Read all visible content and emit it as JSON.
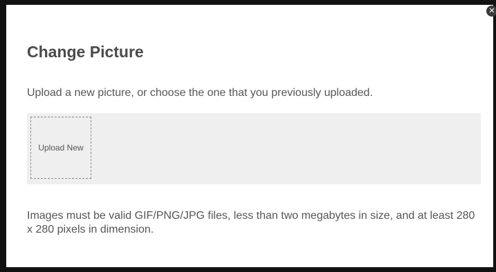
{
  "dialog": {
    "title": "Change Picture",
    "description": "Upload a new picture, or choose the one that you previously uploaded.",
    "upload_new_label": "Upload New",
    "note": "Images must be valid GIF/PNG/JPG files, less than two megabytes in size, and at least 280 x 280 pixels in dimension.",
    "close_glyph": "✕"
  }
}
